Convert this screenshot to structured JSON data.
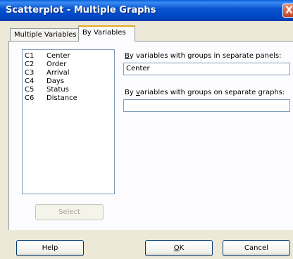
{
  "window": {
    "title": "Scatterplot - Multiple Graphs",
    "close_glyph": "X"
  },
  "tabs": [
    {
      "label": "Multiple Variables",
      "active": false
    },
    {
      "label": "By Variables",
      "active": true
    }
  ],
  "variables": [
    {
      "id": "C1",
      "name": "Center"
    },
    {
      "id": "C2",
      "name": "Order"
    },
    {
      "id": "C3",
      "name": "Arrival"
    },
    {
      "id": "C4",
      "name": "Days"
    },
    {
      "id": "C5",
      "name": "Status"
    },
    {
      "id": "C6",
      "name": "Distance"
    }
  ],
  "select_button": {
    "label": "Select",
    "enabled": false
  },
  "panels_field": {
    "label_prefix": "",
    "label_underlined": "B",
    "label_suffix": "y variables with groups in separate panels:",
    "value": "Center"
  },
  "graphs_field": {
    "label_prefix": "By ",
    "label_underlined": "v",
    "label_suffix": "ariables with groups on separate graphs:",
    "value": ""
  },
  "footer": {
    "help_label": "Help",
    "ok_underlined": "O",
    "ok_suffix": "K",
    "cancel_label": "Cancel"
  },
  "colors": {
    "titlebar": "#0a55d0",
    "dialog_bg": "#ece9d8",
    "panel_bg": "#fcfcfe",
    "tab_highlight": "#e6a92a"
  }
}
